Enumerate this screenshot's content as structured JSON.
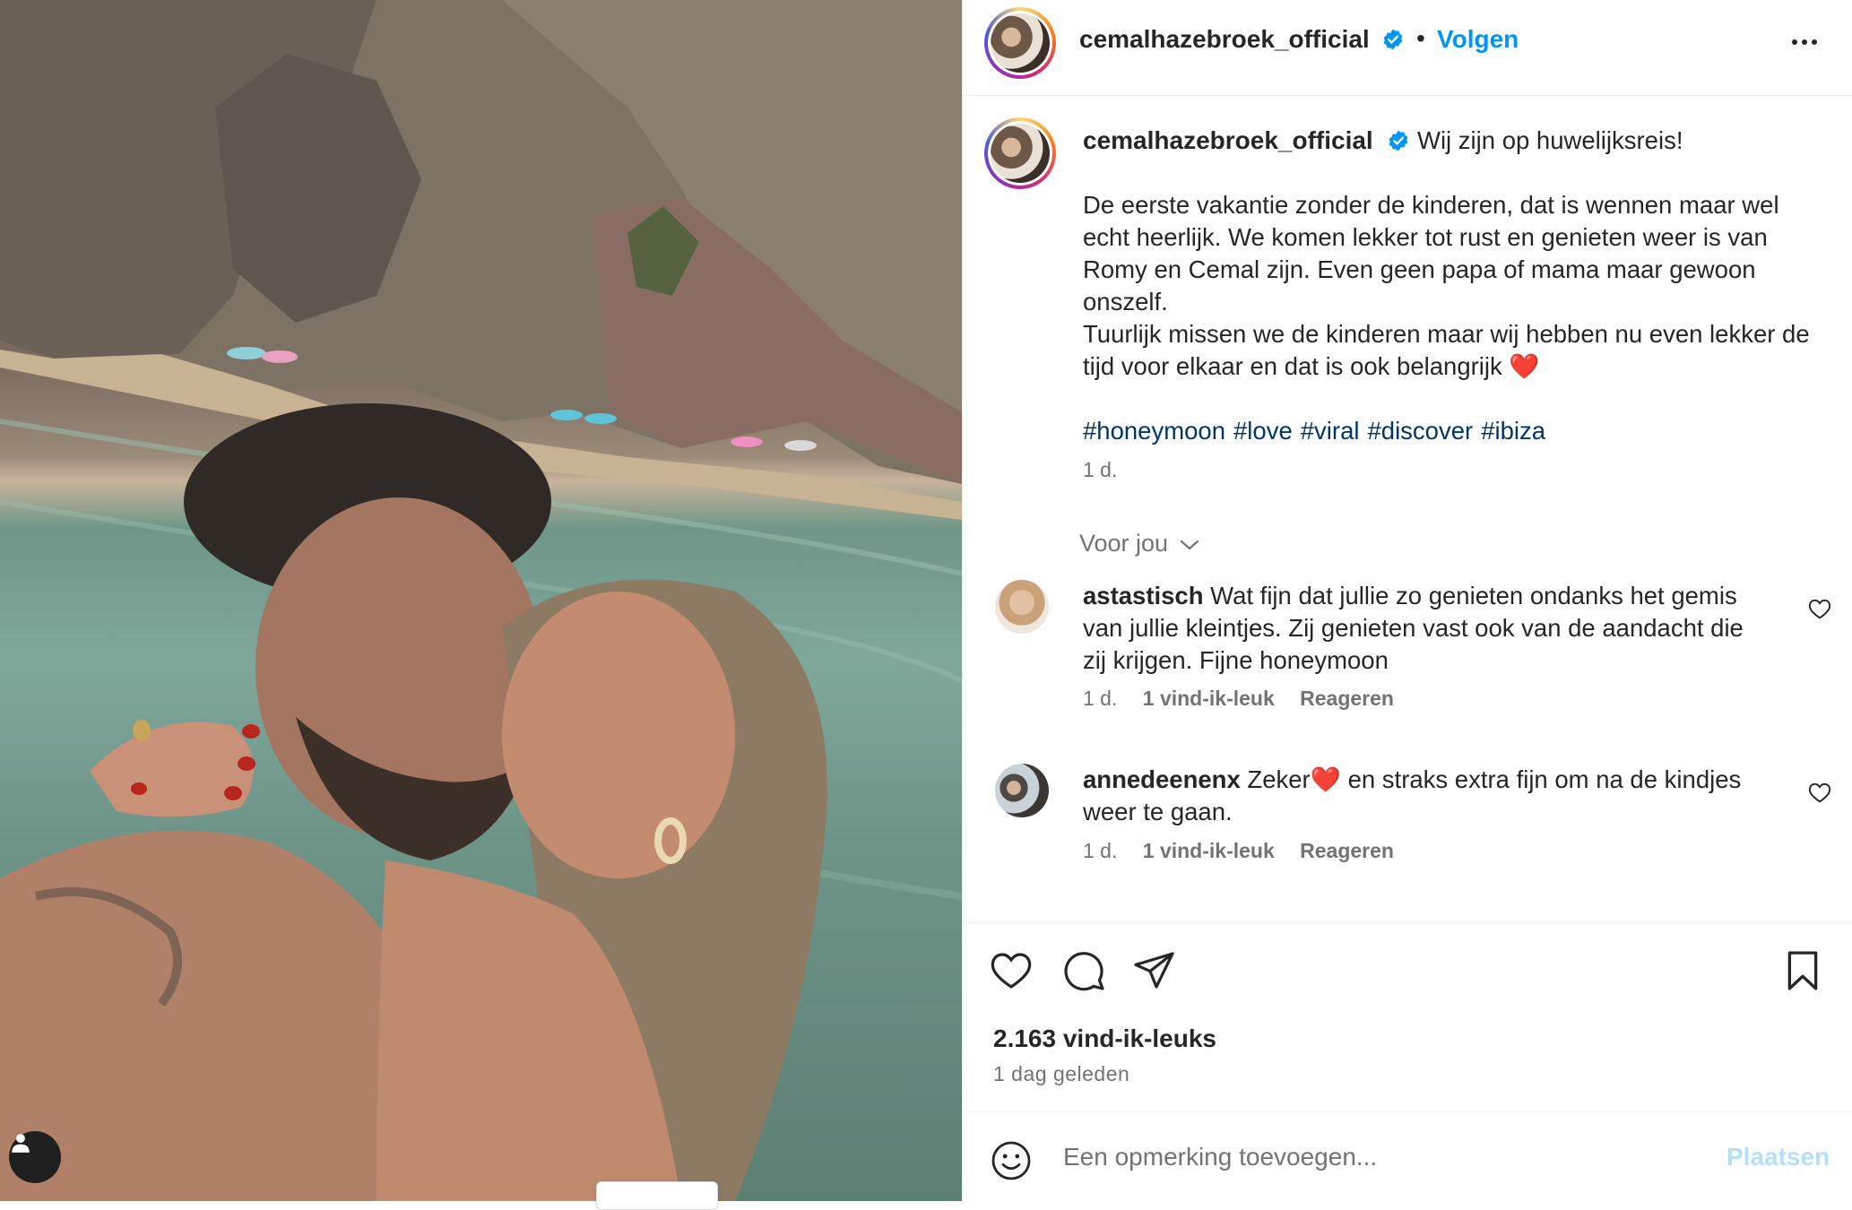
{
  "post": {
    "username": "cemalhazebroek_official",
    "separator": "•",
    "follow_label": "Volgen",
    "more_icon": "more-horizontal-icon",
    "verified_icon": "verified-badge-icon"
  },
  "caption": {
    "username": "cemalhazebroek_official",
    "line1": "Wij zijn op huwelijksreis!",
    "paragraph": "De eerste vakantie zonder de kinderen, dat is wennen maar wel echt heerlijk. We komen lekker tot rust en genieten weer is van Romy en Cemal zijn. Even geen papa of mama maar gewoon onszelf.",
    "paragraph2": "Tuurlijk missen we de kinderen maar wij hebben nu even lekker de tijd voor elkaar en dat is ook belangrijk ❤️",
    "hashtags": [
      "#honeymoon",
      "#love",
      "#viral",
      "#discover",
      "#ibiza"
    ],
    "time": "1 d."
  },
  "for_you": {
    "label": "Voor jou",
    "icon": "chevron-down-icon"
  },
  "comments": [
    {
      "username": "astastisch",
      "text": "Wat fijn dat jullie zo genieten ondanks het gemis van jullie kleintjes. Zij genieten vast ook van de aandacht die zij krijgen. Fijne honeymoon",
      "time": "1 d.",
      "likes": "1 vind-ik-leuk",
      "reply": "Reageren"
    },
    {
      "username": "annedeenenx",
      "text": "Zeker❤️ en straks extra fijn om na de kindjes weer te gaan.",
      "time": "1 d.",
      "likes": "1 vind-ik-leuk",
      "reply": "Reageren"
    }
  ],
  "actions": {
    "like_icon": "heart-icon",
    "comment_icon": "comment-icon",
    "share_icon": "share-icon",
    "save_icon": "bookmark-icon",
    "likes_count": "2.163 vind-ik-leuks",
    "posted": "1 dag geleden"
  },
  "composer": {
    "emoji_icon": "emoji-icon",
    "placeholder": "Een opmerking toevoegen...",
    "post_label": "Plaatsen"
  },
  "media": {
    "tag_icon": "user-tag-icon"
  }
}
